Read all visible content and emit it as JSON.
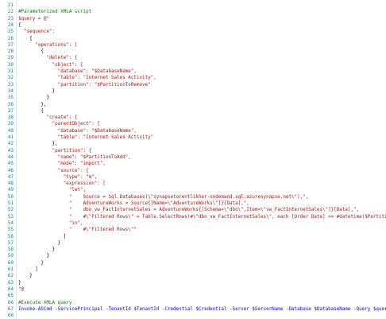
{
  "editor": {
    "line_numbers": [
      "21",
      "22",
      "23",
      "24",
      "25",
      "26",
      "27",
      "28",
      "29",
      "30",
      "31",
      "32",
      "33",
      "34",
      "35",
      "36",
      "37",
      "38",
      "39",
      "40",
      "41",
      "42",
      "43",
      "44",
      "45",
      "46",
      "47",
      "48",
      "49",
      "50",
      "51",
      "52",
      "53",
      "54",
      "55",
      "56",
      "57",
      "58",
      "59",
      "60",
      "61",
      "62",
      "63",
      "64",
      "65",
      "66",
      "67",
      "68"
    ],
    "lines": [
      "",
      "#Parameterized XMLA script",
      "$query = @\"",
      "{",
      "  \"sequence\":",
      "    {",
      "      \"operations\": [",
      "        {",
      "          \"delete\": {",
      "            \"object\": {",
      "              \"database\": \"$DatabaseName\",",
      "              \"table\": \"Internet Sales Activity\",",
      "              \"partition\": \"$PartitionToRemove\"",
      "            }",
      "          }",
      "        },",
      "        {",
      "          \"create\": {",
      "            \"parentObject\": {",
      "              \"database\": \"$DatabaseName\",",
      "              \"table\": \"Internet Sales Activity\"",
      "            },",
      "            \"partition\": {",
      "              \"name\": \"$PartitionToAdd\",",
      "              \"mode\": \"import\",",
      "              \"source\": {",
      "                \"type\": \"m\",",
      "                \"expression\": [",
      "                  \"let\",",
      "                  \"    Source = Sql.Databases(\\\"synapsetorentlikher-ondemand.sql.azuresynapse.net\\\"),\",",
      "                  \"    AdventureWorks = Source{[Name=\\\"AdventureWorks\\\"]}[Data],\",",
      "                  \"    dbo_vw_FactInternetSales = AdventureWorks{[Schema=\\\"dbo\\\",Item=\\\"vw_FactInternetSales\\\"]}[Data],\",",
      "                  \"    #\\\"Filtered Rows\\\" = Table.SelectRows(#\\\"dbo_vw_FactInternetSales\\\", each [Order Date] >= #datetime($PartitionToAdd",
      "                  \"in\",",
      "                  \"    #\\\"Filtered Rows\\\"\"",
      "                ]",
      "              }",
      "            }",
      "          }",
      "        }",
      "      ]",
      "    }",
      "}",
      "\"@",
      "",
      "#Execute XMLA query",
      "Invoke-ASCmd -ServicePrincipal -TenantId $TenantId -Credential $Credential -Server $ServerName -Database $DatabaseName -Query $query",
      ""
    ]
  }
}
